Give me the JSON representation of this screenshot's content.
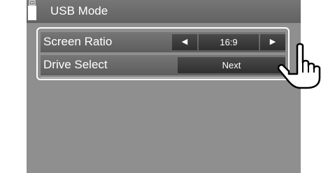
{
  "header": {
    "title": "USB Mode",
    "icon": "usb-drive-icon"
  },
  "settings": [
    {
      "label": "Screen Ratio",
      "control": "stepper",
      "value": "16:9",
      "left_arrow": "◀",
      "right_arrow": "▶"
    },
    {
      "label": "Drive Select",
      "control": "button",
      "button_label": "Next"
    }
  ],
  "overlay": {
    "icon": "pointing-hand-icon"
  },
  "colors": {
    "screen_bg": "#8f8f8f",
    "bar_bg": "#6b6b6b",
    "control_bg": "#3c3c3c",
    "text": "#ffffff"
  }
}
